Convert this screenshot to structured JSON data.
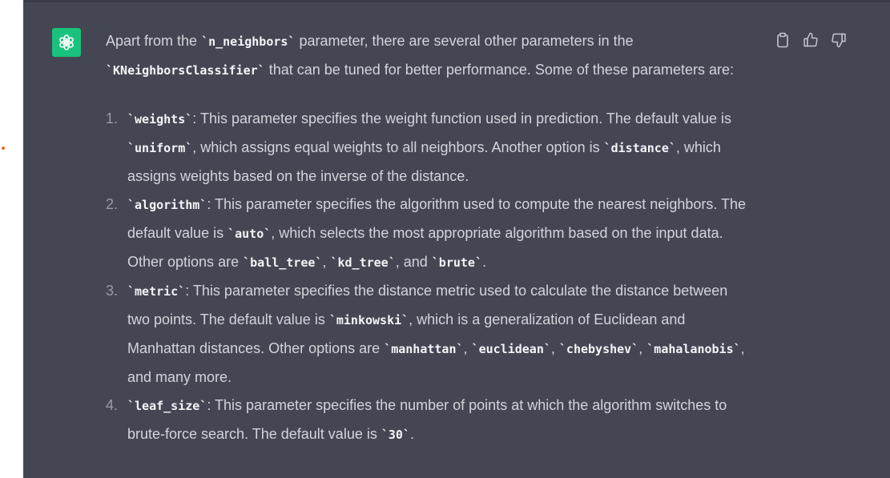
{
  "avatar": {
    "icon": "openai-logo-icon",
    "color": "#19c37d"
  },
  "actions": {
    "copy_icon": "clipboard-icon",
    "like_icon": "thumbs-up-icon",
    "dislike_icon": "thumbs-down-icon"
  },
  "message": {
    "intro": {
      "t1": "Apart from the ",
      "c1": "`n_neighbors`",
      "t2": " parameter, there are several other parameters in the ",
      "c2": "`KNeighborsClassifier`",
      "t3": " that can be tuned for better performance. Some of these parameters are:"
    },
    "items": [
      {
        "num": "1.",
        "c1": "`weights`",
        "t1": ": This parameter specifies the weight function used in prediction. The default value is ",
        "c2": "`uniform`",
        "t2": ", which assigns equal weights to all neighbors. Another option is ",
        "c3": "`distance`",
        "t3": ", which assigns weights based on the inverse of the distance."
      },
      {
        "num": "2.",
        "c1": "`algorithm`",
        "t1": ": This parameter specifies the algorithm used to compute the nearest neighbors. The default value is ",
        "c2": "`auto`",
        "t2": ", which selects the most appropriate algorithm based on the input data. Other options are ",
        "c3": "`ball_tree`",
        "t3": ", ",
        "c4": "`kd_tree`",
        "t4": ", and ",
        "c5": "`brute`",
        "t5": "."
      },
      {
        "num": "3.",
        "c1": "`metric`",
        "t1": ": This parameter specifies the distance metric used to calculate the distance between two points. The default value is ",
        "c2": "`minkowski`",
        "t2": ", which is a generalization of Euclidean and Manhattan distances. Other options are ",
        "c3": "`manhattan`",
        "t3": ", ",
        "c4": "`euclidean`",
        "t4": ", ",
        "c5": "`chebyshev`",
        "t5": ", ",
        "c6": "`mahalanobis`",
        "t6": ", and many more."
      },
      {
        "num": "4.",
        "c1": "`leaf_size`",
        "t1": ": This parameter specifies the number of points at which the algorithm switches to brute-force search. The default value is ",
        "c2": "`30`",
        "t2": "."
      }
    ]
  },
  "colors": {
    "background": "#444654",
    "text": "#d1d5db",
    "accent": "#19c37d"
  }
}
